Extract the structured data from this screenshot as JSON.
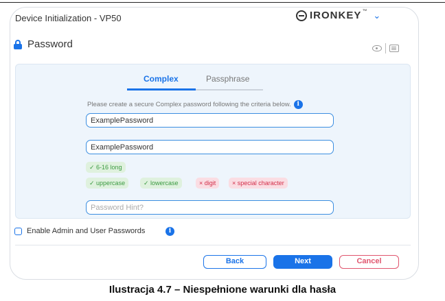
{
  "window": {
    "title": "Device Initialization - VP50",
    "logo_text": "IRONKEY",
    "logo_tm": "™"
  },
  "section": {
    "title": "Password"
  },
  "tabs": [
    {
      "label": "Complex",
      "active": true
    },
    {
      "label": "Passphrase",
      "active": false
    }
  ],
  "instructions": "Please create a secure Complex password following the criteria below.",
  "fields": {
    "password_value": "ExamplePassword",
    "confirm_value": "ExamplePassword",
    "hint_placeholder": "Password Hint?"
  },
  "criteria": [
    {
      "label": "✓ 6-16 long",
      "met": true
    },
    {
      "label": "✓ uppercase",
      "met": true
    },
    {
      "label": "✓ lowercase",
      "met": true
    },
    {
      "label": "× digit",
      "met": false
    },
    {
      "label": "× special character",
      "met": false
    }
  ],
  "admin_option": {
    "label": "Enable Admin and User Passwords",
    "checked": false
  },
  "buttons": {
    "back": "Back",
    "next": "Next",
    "cancel": "Cancel"
  },
  "caption": "Ilustracja 4.7 – Niespełnione warunki dla hasła",
  "colors": {
    "accent": "#1a73e8",
    "ok_bg": "#dff1de",
    "ok_text": "#3b9a41",
    "bad_bg": "#fadde3",
    "bad_text": "#d32f4a",
    "cancel": "#e0546d"
  },
  "icons": [
    "ironkey-logo-icon",
    "chevron-down-icon",
    "lock-icon",
    "eye-icon",
    "keyboard-icon",
    "info-icon"
  ]
}
